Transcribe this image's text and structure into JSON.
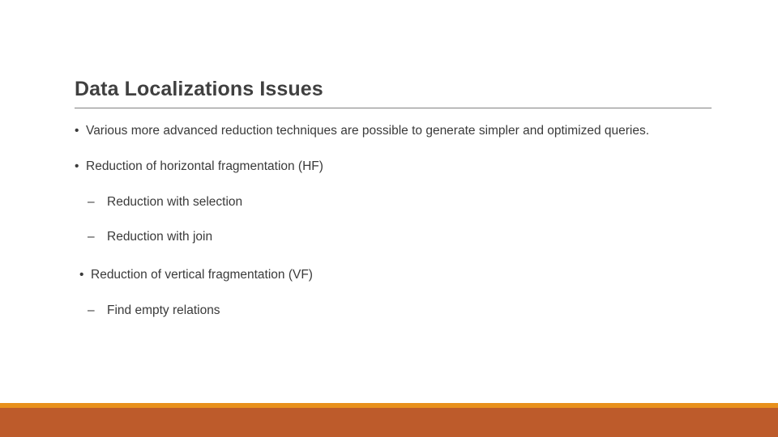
{
  "slide": {
    "title": "Data Localizations Issues",
    "content": [
      {
        "level": 1,
        "marker": "•",
        "text": "Various more advanced reduction techniques are possible to generate simpler and optimized queries.",
        "indented": false
      },
      {
        "level": 1,
        "marker": "•",
        "text": "Reduction of horizontal fragmentation (HF)",
        "indented": false
      },
      {
        "level": 2,
        "marker": "–",
        "text": "Reduction with selection",
        "indented": false
      },
      {
        "level": 2,
        "marker": "–",
        "text": "Reduction with join",
        "indented": false
      },
      {
        "level": 1,
        "marker": "•",
        "text": "Reduction of vertical fragmentation (VF)",
        "indented": true
      },
      {
        "level": 2,
        "marker": "–",
        "text": "Find empty relations",
        "indented": false
      }
    ]
  },
  "theme": {
    "background": "#ffffff",
    "title_color": "#404040",
    "body_color": "#3a3a3a",
    "rule_color": "#808080",
    "footer_stripe_color": "#e8901c",
    "footer_band_color": "#bd5b2b"
  }
}
